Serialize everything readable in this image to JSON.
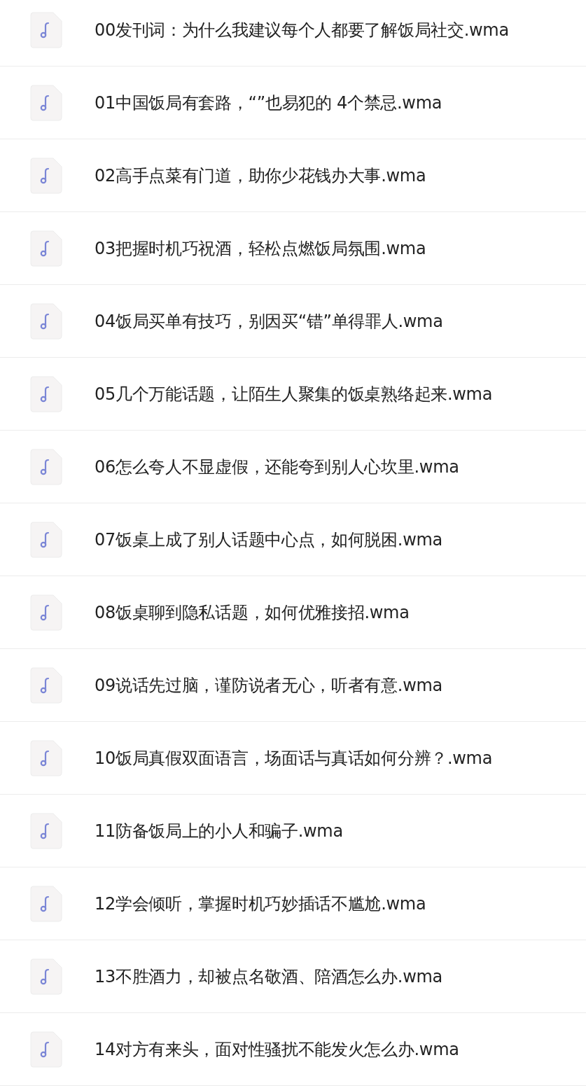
{
  "files": [
    {
      "name": "00发刊词：为什么我建议每个人都要了解饭局社交.wma"
    },
    {
      "name": "01中国饭局有套路，“”也易犯的 4个禁忌.wma"
    },
    {
      "name": "02高手点菜有门道，助你少花钱办大事.wma"
    },
    {
      "name": "03把握时机巧祝酒，轻松点燃饭局氛围.wma"
    },
    {
      "name": "04饭局买单有技巧，别因买“错”单得罪人.wma"
    },
    {
      "name": "05几个万能话题，让陌生人聚集的饭桌熟络起来.wma"
    },
    {
      "name": "06怎么夸人不显虚假，还能夸到别人心坎里.wma"
    },
    {
      "name": "07饭桌上成了别人话题中心点，如何脱困.wma"
    },
    {
      "name": "08饭桌聊到隐私话题，如何优雅接招.wma"
    },
    {
      "name": "09说话先过脑，谨防说者无心，听者有意.wma"
    },
    {
      "name": "10饭局真假双面语言，场面话与真话如何分辨？.wma"
    },
    {
      "name": "11防备饭局上的小人和骗子.wma"
    },
    {
      "name": "12学会倾听，掌握时机巧妙插话不尴尬.wma"
    },
    {
      "name": "13不胜酒力，却被点名敬酒、陪酒怎么办.wma"
    },
    {
      "name": "14对方有来头，面对性骚扰不能发火怎么办.wma"
    }
  ]
}
